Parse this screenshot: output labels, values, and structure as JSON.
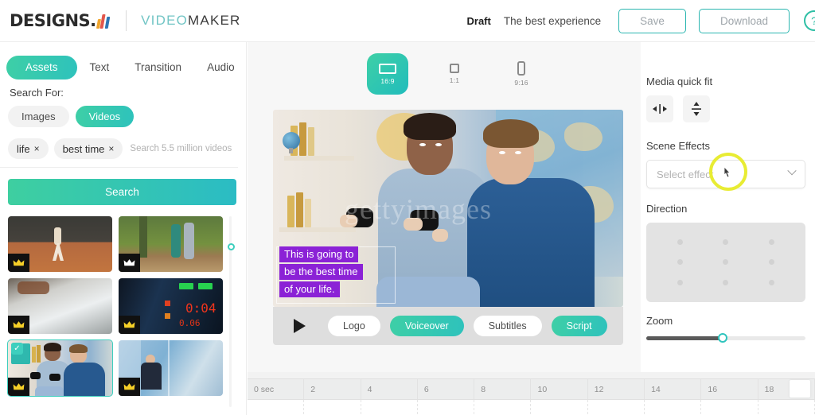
{
  "header": {
    "logo_text": "DESIGNS.",
    "product_name_a": "VIDEO",
    "product_name_b": "MAKER",
    "draft_label": "Draft",
    "project_title": "The best experience",
    "save_label": "Save",
    "download_label": "Download",
    "help_icon": "help-circle-icon",
    "help_glyph": "?"
  },
  "left_panel": {
    "tabs": [
      {
        "label": "Assets",
        "active": true
      },
      {
        "label": "Text",
        "active": false
      },
      {
        "label": "Transition",
        "active": false
      },
      {
        "label": "Audio",
        "active": false
      }
    ],
    "search_for_label": "Search For:",
    "media_types": [
      {
        "label": "Images",
        "active": false
      },
      {
        "label": "Videos",
        "active": true
      }
    ],
    "tags": [
      {
        "label": "life",
        "remove": "×"
      },
      {
        "label": "best time",
        "remove": "×"
      }
    ],
    "search_placeholder": "Search 5.5 million videos",
    "search_button": "Search",
    "thumbnails": [
      {
        "name": "tennis-player",
        "premium": true,
        "selected": false
      },
      {
        "name": "elderly-couple-park",
        "premium": true,
        "selected": false
      },
      {
        "name": "snow-ground",
        "premium": true,
        "selected": false
      },
      {
        "name": "led-scoreboard",
        "premium": true,
        "selected": false
      },
      {
        "name": "boys-gaming",
        "premium": true,
        "selected": true
      },
      {
        "name": "man-glass-building",
        "premium": true,
        "selected": false
      }
    ]
  },
  "center": {
    "ratios": [
      {
        "label": "16:9",
        "active": true
      },
      {
        "label": "1:1",
        "active": false
      },
      {
        "label": "9:16",
        "active": false
      }
    ],
    "watermark": "gettyimages",
    "subtitles": [
      "This is going to",
      "be the best time",
      "of your life."
    ],
    "controls": [
      {
        "label": "Logo",
        "active": false
      },
      {
        "label": "Voiceover",
        "active": true
      },
      {
        "label": "Subtitles",
        "active": false
      },
      {
        "label": "Script",
        "active": true
      }
    ],
    "play_icon": "play-icon"
  },
  "right_panel": {
    "media_quick_fit_label": "Media quick fit",
    "fit_icons": [
      "fit-horizontal-icon",
      "fit-vertical-icon"
    ],
    "scene_effects_label": "Scene Effects",
    "scene_effects_placeholder": "Select effect",
    "direction_label": "Direction",
    "zoom_label": "Zoom",
    "zoom_value": 48
  },
  "timeline": {
    "marks": [
      "0 sec",
      "2",
      "4",
      "6",
      "8",
      "10",
      "12",
      "14",
      "16",
      "18"
    ]
  },
  "colors": {
    "accent_teal": "#2ec2bc",
    "accent_green": "#3ecfa6",
    "subtitle_purple": "#8b22d6",
    "cursor_highlight": "#e8ec33"
  }
}
